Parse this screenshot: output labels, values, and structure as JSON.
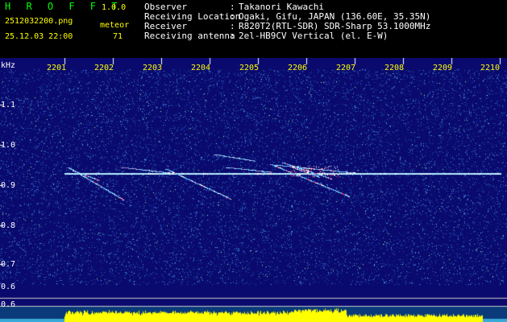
{
  "app": {
    "name": "H R O F F T",
    "version": "1.0.0"
  },
  "file": "2512032200.png",
  "datetime": "25.12.03 22:00",
  "meteor": {
    "label": "meteor",
    "count": "71"
  },
  "info": [
    {
      "key": "Observer",
      "value": "Takanori Kawachi"
    },
    {
      "key": "Receiving Location",
      "value": "Ogaki, Gifu, JAPAN (136.60E, 35.35N)"
    },
    {
      "key": "Receiver",
      "value": "R820T2(RTL-SDR) SDR-Sharp 53.1000MHz"
    },
    {
      "key": "Receiving antenna",
      "value": "2el-HB9CV Vertical (el. E-W)"
    }
  ],
  "y_unit": "kHz",
  "x_ticks": [
    "2201",
    "2202",
    "2203",
    "2204",
    "2205",
    "2206",
    "2207",
    "2208",
    "2209",
    "2210"
  ],
  "y_ticks": [
    "1.1",
    "1.0",
    "0.9",
    "0.8",
    "0.7",
    "0.6",
    "0.5",
    "0.6"
  ],
  "colors": {
    "background": "#0a0a6e",
    "carrier": "#b0f0ff",
    "meteor": "#ffffff",
    "meteor_hot": "#ff3060",
    "level": "#ffff00",
    "label": "#ffff00"
  }
}
